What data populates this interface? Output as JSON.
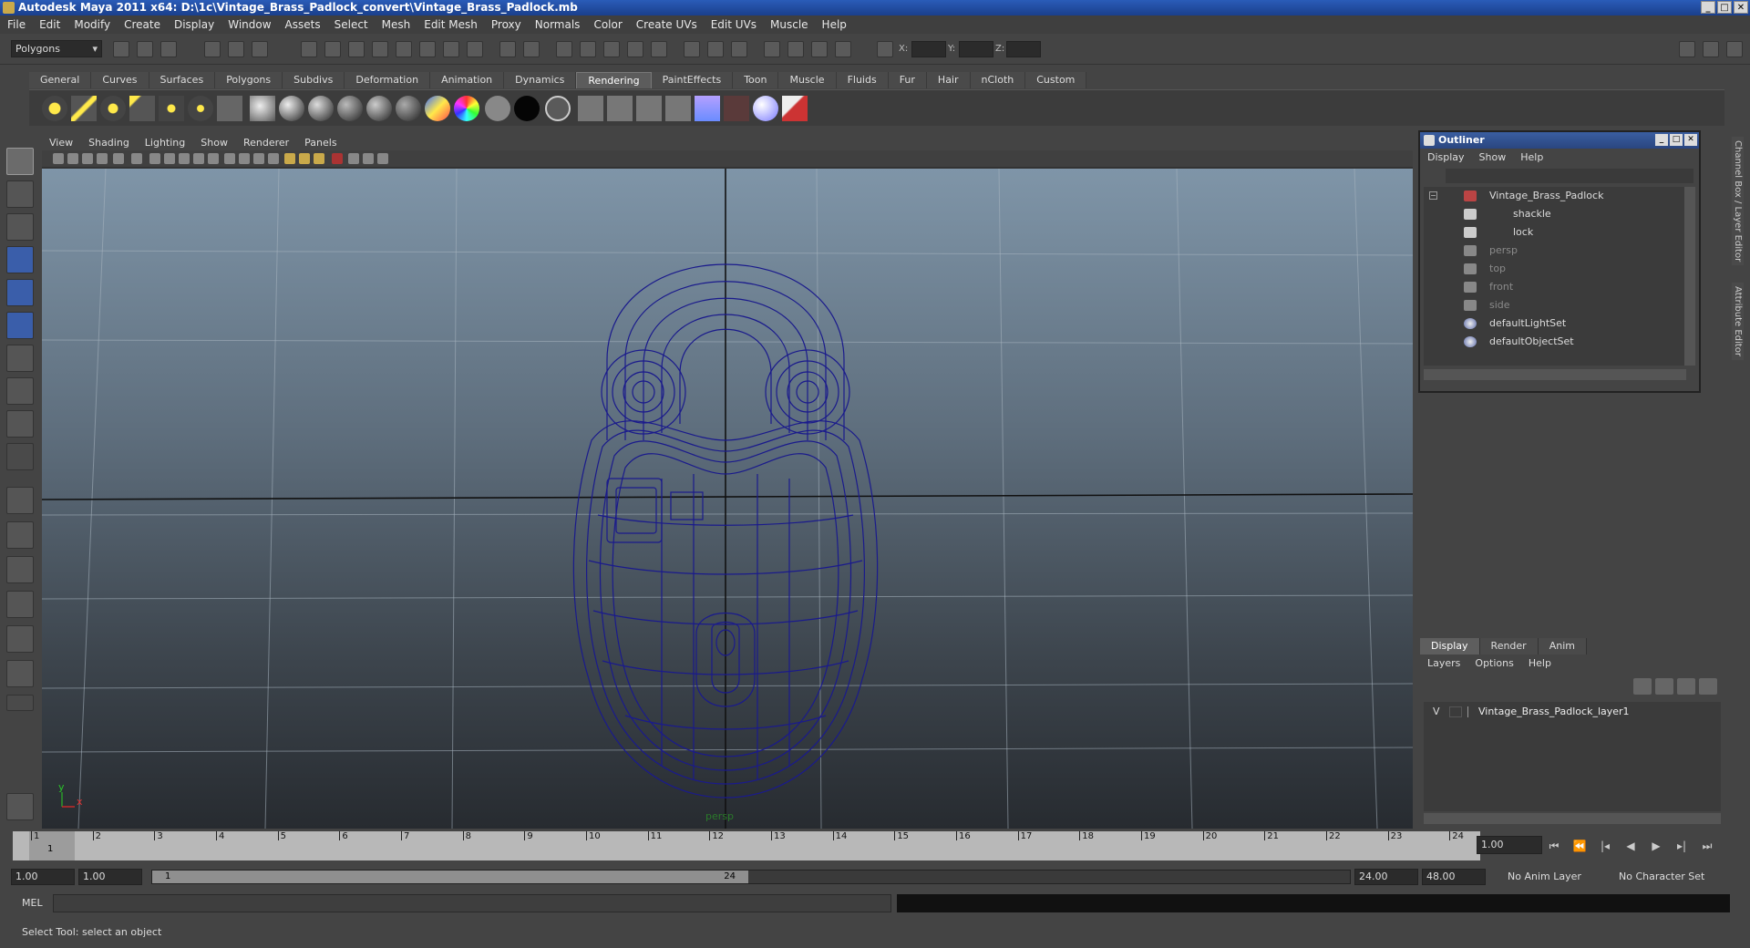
{
  "window": {
    "title": "Autodesk Maya 2011 x64: D:\\1c\\Vintage_Brass_Padlock_convert\\Vintage_Brass_Padlock.mb"
  },
  "menubar": [
    "File",
    "Edit",
    "Modify",
    "Create",
    "Display",
    "Window",
    "Assets",
    "Select",
    "Mesh",
    "Edit Mesh",
    "Proxy",
    "Normals",
    "Color",
    "Create UVs",
    "Edit UVs",
    "Muscle",
    "Help"
  ],
  "statusline": {
    "mode": "Polygons",
    "x_label": "X:",
    "y_label": "Y:",
    "z_label": "Z:"
  },
  "shelf": {
    "tabs": [
      "General",
      "Curves",
      "Surfaces",
      "Polygons",
      "Subdivs",
      "Deformation",
      "Animation",
      "Dynamics",
      "Rendering",
      "PaintEffects",
      "Toon",
      "Muscle",
      "Fluids",
      "Fur",
      "Hair",
      "nCloth",
      "Custom"
    ],
    "active_tab": "Rendering"
  },
  "viewport": {
    "menu": [
      "View",
      "Shading",
      "Lighting",
      "Show",
      "Renderer",
      "Panels"
    ],
    "camera_label": "persp",
    "axis_y": "y",
    "axis_x": "x",
    "wire_color": "#1a1a8c"
  },
  "outliner": {
    "title": "Outliner",
    "menu": [
      "Display",
      "Show",
      "Help"
    ],
    "items": [
      {
        "label": "Vintage_Brass_Padlock",
        "icon": "group-icon",
        "dim": false
      },
      {
        "label": "shackle",
        "icon": "mesh-icon",
        "dim": false
      },
      {
        "label": "lock",
        "icon": "mesh-icon",
        "dim": false
      },
      {
        "label": "persp",
        "icon": "camera-icon",
        "dim": true
      },
      {
        "label": "top",
        "icon": "camera-icon",
        "dim": true
      },
      {
        "label": "front",
        "icon": "camera-icon",
        "dim": true
      },
      {
        "label": "side",
        "icon": "camera-icon",
        "dim": true
      },
      {
        "label": "defaultLightSet",
        "icon": "set-icon",
        "dim": false
      },
      {
        "label": "defaultObjectSet",
        "icon": "set-icon",
        "dim": false
      }
    ]
  },
  "sidetabs": {
    "channel_box": "Channel Box / Layer Editor",
    "attribute_editor": "Attribute Editor"
  },
  "layer_editor": {
    "tabs": [
      "Display",
      "Render",
      "Anim"
    ],
    "active_tab": "Display",
    "menu": [
      "Layers",
      "Options",
      "Help"
    ],
    "layer": {
      "visible": "V",
      "name": "Vintage_Brass_Padlock_layer1"
    }
  },
  "timeslider": {
    "ticks": [
      "1",
      "2",
      "3",
      "4",
      "5",
      "6",
      "7",
      "8",
      "9",
      "10",
      "11",
      "12",
      "13",
      "14",
      "15",
      "16",
      "17",
      "18",
      "19",
      "20",
      "21",
      "22",
      "23",
      "24"
    ],
    "current": "1",
    "current_frame_field": "1.00"
  },
  "range": {
    "start": "1.00",
    "inner_start": "1.00",
    "slider_start": "1",
    "slider_end": "24",
    "end": "24.00",
    "outer_end": "48.00",
    "anim_layer": "No Anim Layer",
    "char_set": "No Character Set"
  },
  "cmdline": {
    "label": "MEL"
  },
  "helpline": {
    "text": "Select Tool: select an object"
  }
}
